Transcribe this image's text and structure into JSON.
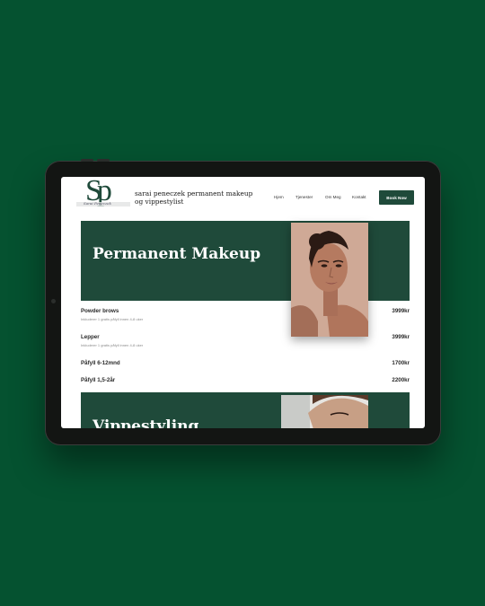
{
  "site": {
    "logo_letters": "Sp",
    "logo_script": "Sarai Peneczek",
    "title": "sarai peneczek permanent makeup og vippestylist"
  },
  "nav": {
    "items": [
      "Hjem",
      "Tjenester",
      "Om Meg",
      "Kontakt"
    ],
    "book_label": "Book Now"
  },
  "hero": {
    "title": "Permanent Makeup"
  },
  "prices": [
    {
      "name": "Powder brows",
      "price": "3999kr",
      "note": "Inkluderer 1 gratis påfyll innen 4-8 uker"
    },
    {
      "name": "Lepper",
      "price": "3999kr",
      "note": "Inkluderer 1 gratis påfyll innen 4-8 uker"
    },
    {
      "name": "Påfyll 6-12mnd",
      "price": "1700kr",
      "note": ""
    },
    {
      "name": "Påfyll 1,5-2år",
      "price": "2200kr",
      "note": ""
    }
  ],
  "hero2": {
    "title": "Vippestyling"
  },
  "colors": {
    "background": "#055230",
    "brand": "#1f4a3a",
    "device": "#131513"
  }
}
